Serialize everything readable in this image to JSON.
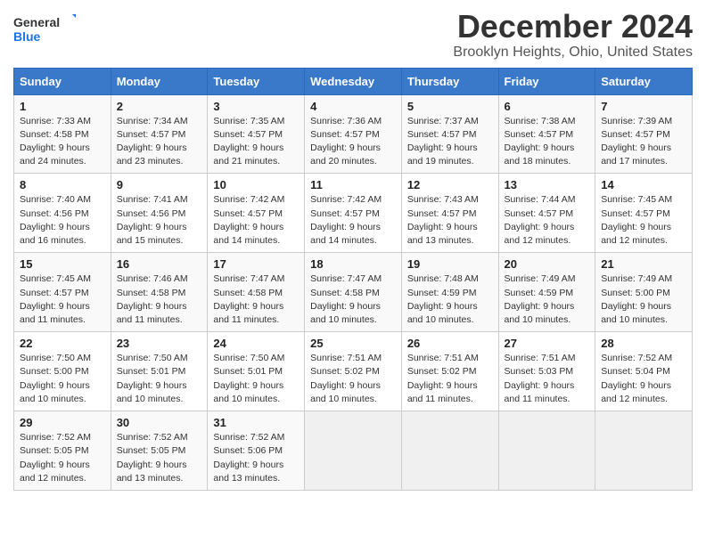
{
  "logo": {
    "general": "General",
    "blue": "Blue"
  },
  "title": "December 2024",
  "location": "Brooklyn Heights, Ohio, United States",
  "days_header": [
    "Sunday",
    "Monday",
    "Tuesday",
    "Wednesday",
    "Thursday",
    "Friday",
    "Saturday"
  ],
  "weeks": [
    [
      {
        "day": "1",
        "sunrise": "Sunrise: 7:33 AM",
        "sunset": "Sunset: 4:58 PM",
        "daylight": "Daylight: 9 hours and 24 minutes."
      },
      {
        "day": "2",
        "sunrise": "Sunrise: 7:34 AM",
        "sunset": "Sunset: 4:57 PM",
        "daylight": "Daylight: 9 hours and 23 minutes."
      },
      {
        "day": "3",
        "sunrise": "Sunrise: 7:35 AM",
        "sunset": "Sunset: 4:57 PM",
        "daylight": "Daylight: 9 hours and 21 minutes."
      },
      {
        "day": "4",
        "sunrise": "Sunrise: 7:36 AM",
        "sunset": "Sunset: 4:57 PM",
        "daylight": "Daylight: 9 hours and 20 minutes."
      },
      {
        "day": "5",
        "sunrise": "Sunrise: 7:37 AM",
        "sunset": "Sunset: 4:57 PM",
        "daylight": "Daylight: 9 hours and 19 minutes."
      },
      {
        "day": "6",
        "sunrise": "Sunrise: 7:38 AM",
        "sunset": "Sunset: 4:57 PM",
        "daylight": "Daylight: 9 hours and 18 minutes."
      },
      {
        "day": "7",
        "sunrise": "Sunrise: 7:39 AM",
        "sunset": "Sunset: 4:57 PM",
        "daylight": "Daylight: 9 hours and 17 minutes."
      }
    ],
    [
      {
        "day": "8",
        "sunrise": "Sunrise: 7:40 AM",
        "sunset": "Sunset: 4:56 PM",
        "daylight": "Daylight: 9 hours and 16 minutes."
      },
      {
        "day": "9",
        "sunrise": "Sunrise: 7:41 AM",
        "sunset": "Sunset: 4:56 PM",
        "daylight": "Daylight: 9 hours and 15 minutes."
      },
      {
        "day": "10",
        "sunrise": "Sunrise: 7:42 AM",
        "sunset": "Sunset: 4:57 PM",
        "daylight": "Daylight: 9 hours and 14 minutes."
      },
      {
        "day": "11",
        "sunrise": "Sunrise: 7:42 AM",
        "sunset": "Sunset: 4:57 PM",
        "daylight": "Daylight: 9 hours and 14 minutes."
      },
      {
        "day": "12",
        "sunrise": "Sunrise: 7:43 AM",
        "sunset": "Sunset: 4:57 PM",
        "daylight": "Daylight: 9 hours and 13 minutes."
      },
      {
        "day": "13",
        "sunrise": "Sunrise: 7:44 AM",
        "sunset": "Sunset: 4:57 PM",
        "daylight": "Daylight: 9 hours and 12 minutes."
      },
      {
        "day": "14",
        "sunrise": "Sunrise: 7:45 AM",
        "sunset": "Sunset: 4:57 PM",
        "daylight": "Daylight: 9 hours and 12 minutes."
      }
    ],
    [
      {
        "day": "15",
        "sunrise": "Sunrise: 7:45 AM",
        "sunset": "Sunset: 4:57 PM",
        "daylight": "Daylight: 9 hours and 11 minutes."
      },
      {
        "day": "16",
        "sunrise": "Sunrise: 7:46 AM",
        "sunset": "Sunset: 4:58 PM",
        "daylight": "Daylight: 9 hours and 11 minutes."
      },
      {
        "day": "17",
        "sunrise": "Sunrise: 7:47 AM",
        "sunset": "Sunset: 4:58 PM",
        "daylight": "Daylight: 9 hours and 11 minutes."
      },
      {
        "day": "18",
        "sunrise": "Sunrise: 7:47 AM",
        "sunset": "Sunset: 4:58 PM",
        "daylight": "Daylight: 9 hours and 10 minutes."
      },
      {
        "day": "19",
        "sunrise": "Sunrise: 7:48 AM",
        "sunset": "Sunset: 4:59 PM",
        "daylight": "Daylight: 9 hours and 10 minutes."
      },
      {
        "day": "20",
        "sunrise": "Sunrise: 7:49 AM",
        "sunset": "Sunset: 4:59 PM",
        "daylight": "Daylight: 9 hours and 10 minutes."
      },
      {
        "day": "21",
        "sunrise": "Sunrise: 7:49 AM",
        "sunset": "Sunset: 5:00 PM",
        "daylight": "Daylight: 9 hours and 10 minutes."
      }
    ],
    [
      {
        "day": "22",
        "sunrise": "Sunrise: 7:50 AM",
        "sunset": "Sunset: 5:00 PM",
        "daylight": "Daylight: 9 hours and 10 minutes."
      },
      {
        "day": "23",
        "sunrise": "Sunrise: 7:50 AM",
        "sunset": "Sunset: 5:01 PM",
        "daylight": "Daylight: 9 hours and 10 minutes."
      },
      {
        "day": "24",
        "sunrise": "Sunrise: 7:50 AM",
        "sunset": "Sunset: 5:01 PM",
        "daylight": "Daylight: 9 hours and 10 minutes."
      },
      {
        "day": "25",
        "sunrise": "Sunrise: 7:51 AM",
        "sunset": "Sunset: 5:02 PM",
        "daylight": "Daylight: 9 hours and 10 minutes."
      },
      {
        "day": "26",
        "sunrise": "Sunrise: 7:51 AM",
        "sunset": "Sunset: 5:02 PM",
        "daylight": "Daylight: 9 hours and 11 minutes."
      },
      {
        "day": "27",
        "sunrise": "Sunrise: 7:51 AM",
        "sunset": "Sunset: 5:03 PM",
        "daylight": "Daylight: 9 hours and 11 minutes."
      },
      {
        "day": "28",
        "sunrise": "Sunrise: 7:52 AM",
        "sunset": "Sunset: 5:04 PM",
        "daylight": "Daylight: 9 hours and 12 minutes."
      }
    ],
    [
      {
        "day": "29",
        "sunrise": "Sunrise: 7:52 AM",
        "sunset": "Sunset: 5:05 PM",
        "daylight": "Daylight: 9 hours and 12 minutes."
      },
      {
        "day": "30",
        "sunrise": "Sunrise: 7:52 AM",
        "sunset": "Sunset: 5:05 PM",
        "daylight": "Daylight: 9 hours and 13 minutes."
      },
      {
        "day": "31",
        "sunrise": "Sunrise: 7:52 AM",
        "sunset": "Sunset: 5:06 PM",
        "daylight": "Daylight: 9 hours and 13 minutes."
      },
      null,
      null,
      null,
      null
    ]
  ]
}
